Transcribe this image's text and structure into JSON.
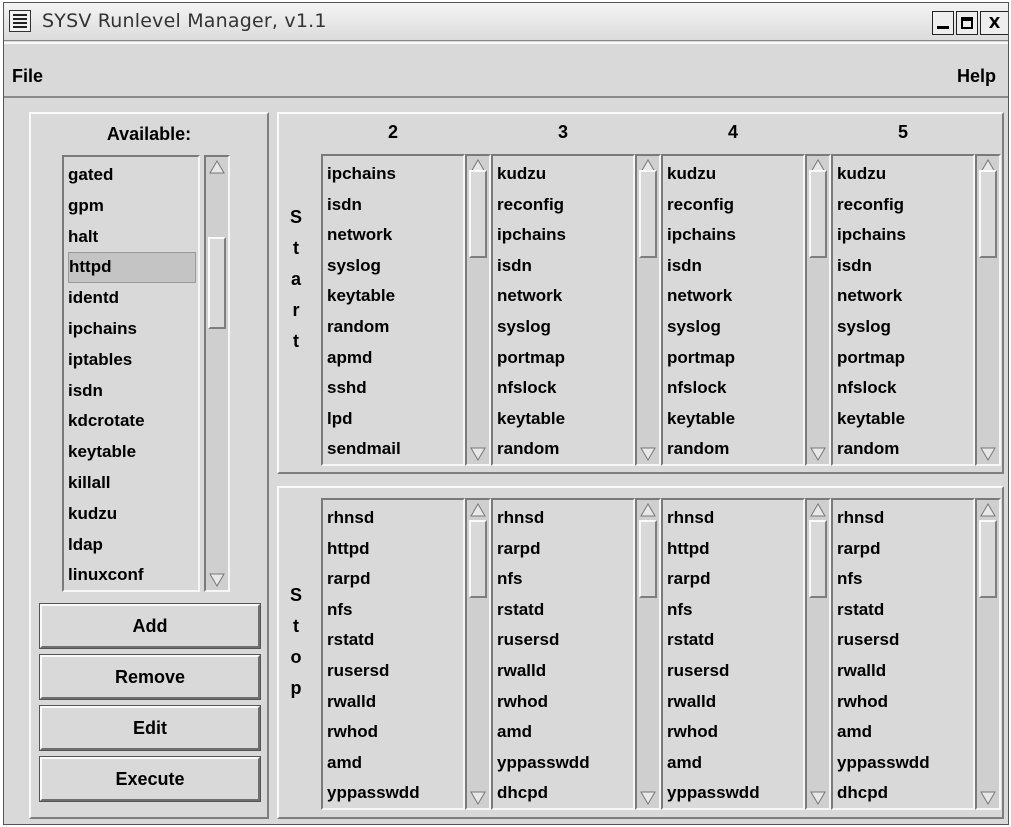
{
  "window": {
    "title": "SYSV Runlevel Manager, v1.1"
  },
  "menubar": {
    "file": "File",
    "help": "Help"
  },
  "available": {
    "label": "Available:",
    "items": [
      "gated",
      "gpm",
      "halt",
      "httpd",
      "identd",
      "ipchains",
      "iptables",
      "isdn",
      "kdcrotate",
      "keytable",
      "killall",
      "kudzu",
      "ldap",
      "linuxconf"
    ],
    "selected": "httpd"
  },
  "buttons": {
    "add": "Add",
    "remove": "Remove",
    "edit": "Edit",
    "execute": "Execute"
  },
  "start_label": [
    "S",
    "t",
    "a",
    "r",
    "t"
  ],
  "stop_label": [
    "S",
    "t",
    "o",
    "p"
  ],
  "runlevels": [
    {
      "level": "2",
      "start": [
        "ipchains",
        "isdn",
        "network",
        "syslog",
        "keytable",
        "random",
        "apmd",
        "sshd",
        "lpd",
        "sendmail"
      ],
      "stop": [
        "rhnsd",
        "httpd",
        "rarpd",
        "nfs",
        "rstatd",
        "rusersd",
        "rwalld",
        "rwhod",
        "amd",
        "yppasswdd"
      ]
    },
    {
      "level": "3",
      "start": [
        "kudzu",
        "reconfig",
        "ipchains",
        "isdn",
        "network",
        "syslog",
        "portmap",
        "nfslock",
        "keytable",
        "random"
      ],
      "stop": [
        "rhnsd",
        "rarpd",
        "nfs",
        "rstatd",
        "rusersd",
        "rwalld",
        "rwhod",
        "amd",
        "yppasswdd",
        "dhcpd"
      ]
    },
    {
      "level": "4",
      "start": [
        "kudzu",
        "reconfig",
        "ipchains",
        "isdn",
        "network",
        "syslog",
        "portmap",
        "nfslock",
        "keytable",
        "random"
      ],
      "stop": [
        "rhnsd",
        "httpd",
        "rarpd",
        "nfs",
        "rstatd",
        "rusersd",
        "rwalld",
        "rwhod",
        "amd",
        "yppasswdd"
      ]
    },
    {
      "level": "5",
      "start": [
        "kudzu",
        "reconfig",
        "ipchains",
        "isdn",
        "network",
        "syslog",
        "portmap",
        "nfslock",
        "keytable",
        "random"
      ],
      "stop": [
        "rhnsd",
        "rarpd",
        "nfs",
        "rstatd",
        "rusersd",
        "rwalld",
        "rwhod",
        "amd",
        "yppasswdd",
        "dhcpd"
      ]
    }
  ]
}
